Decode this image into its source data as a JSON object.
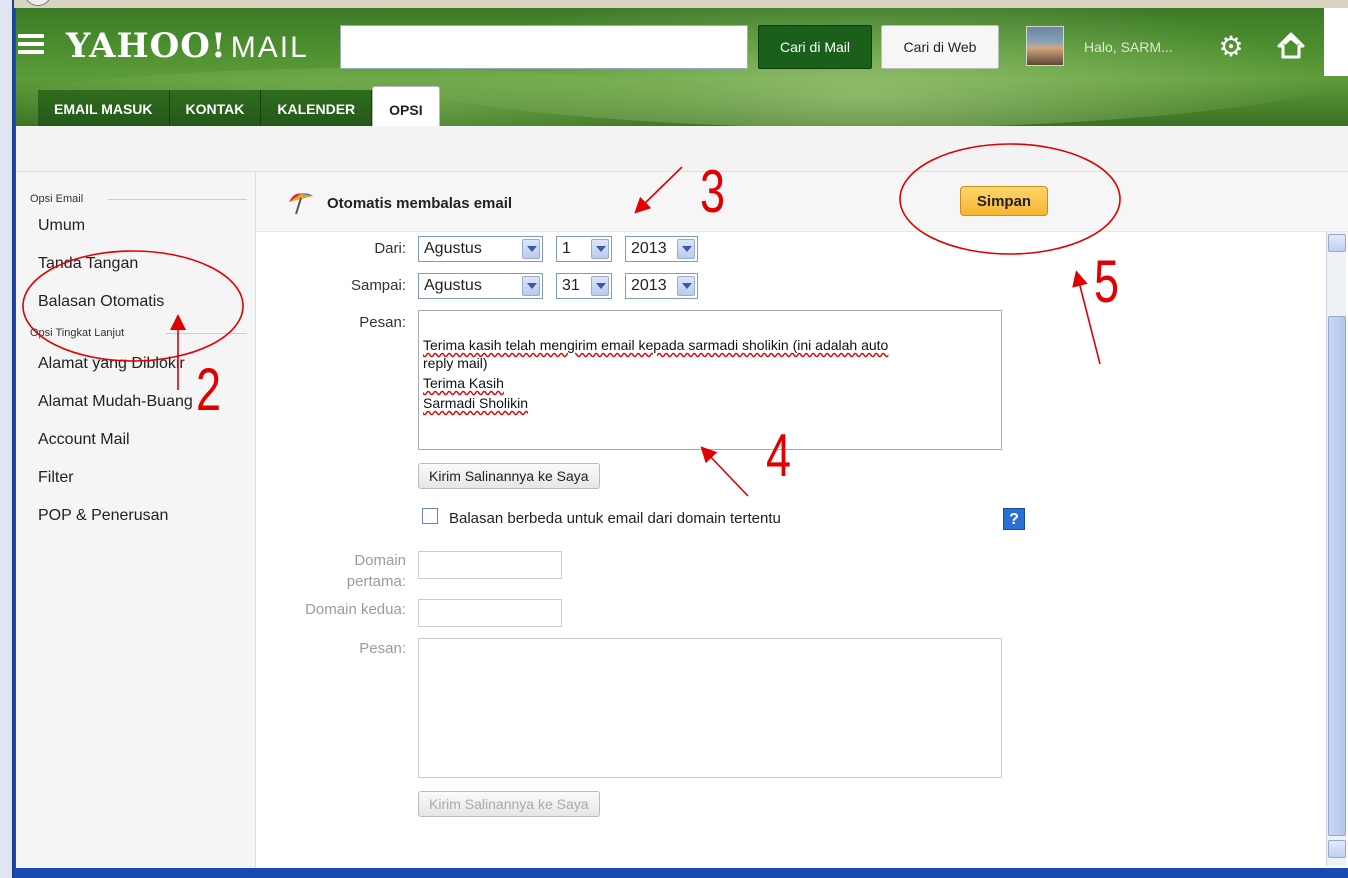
{
  "header": {
    "logo": "YAHOO!",
    "logo_suffix": "MAIL",
    "search_value": "",
    "search_mail_label": "Cari di Mail",
    "search_web_label": "Cari di Web",
    "greeting": "Halo, SARM..."
  },
  "tabs": [
    {
      "label": "EMAIL MASUK"
    },
    {
      "label": "KONTAK"
    },
    {
      "label": "KALENDER"
    },
    {
      "label": "OPSI",
      "active": true
    }
  ],
  "sidebar": {
    "section1": "Opsi Email",
    "items1": [
      "Umum",
      "Tanda Tangan",
      "Balasan Otomatis"
    ],
    "section2": "Opsi Tingkat Lanjut",
    "items2": [
      "Alamat yang Diblokir",
      "Alamat Mudah-Buang",
      "Account Mail",
      "Filter",
      "POP & Penerusan"
    ]
  },
  "panel": {
    "title": "Otomatis membalas email",
    "save_label": "Simpan"
  },
  "form": {
    "from_label": "Dari:",
    "from_month": "Agustus",
    "from_day": "1",
    "from_year": "2013",
    "to_label": "Sampai:",
    "to_month": "Agustus",
    "to_day": "31",
    "to_year": "2013",
    "message_label": "Pesan:",
    "message_lines": [
      "Terima kasih telah mengirim email kepada sarmadi sholikin (ini adalah auto",
      "reply mail)",
      "Terima Kasih",
      "Sarmadi Sholikin"
    ],
    "send_copy_label": "Kirim Salinannya ke Saya",
    "domain_checkbox_label": "Balasan berbeda untuk email dari domain tertentu",
    "help_label": "?",
    "domain1_label_a": "Domain",
    "domain1_label_b": "pertama:",
    "domain2_label": "Domain kedua:",
    "message2_label": "Pesan:",
    "send_copy2_label": "Kirim Salinannya ke Saya"
  },
  "annotations": [
    "2",
    "3",
    "4",
    "5"
  ],
  "colors": {
    "header_green": "#4d8f2f",
    "search_button": "#1a5f1a",
    "save_button": "#f4b632",
    "annotation_red": "#e00000"
  }
}
